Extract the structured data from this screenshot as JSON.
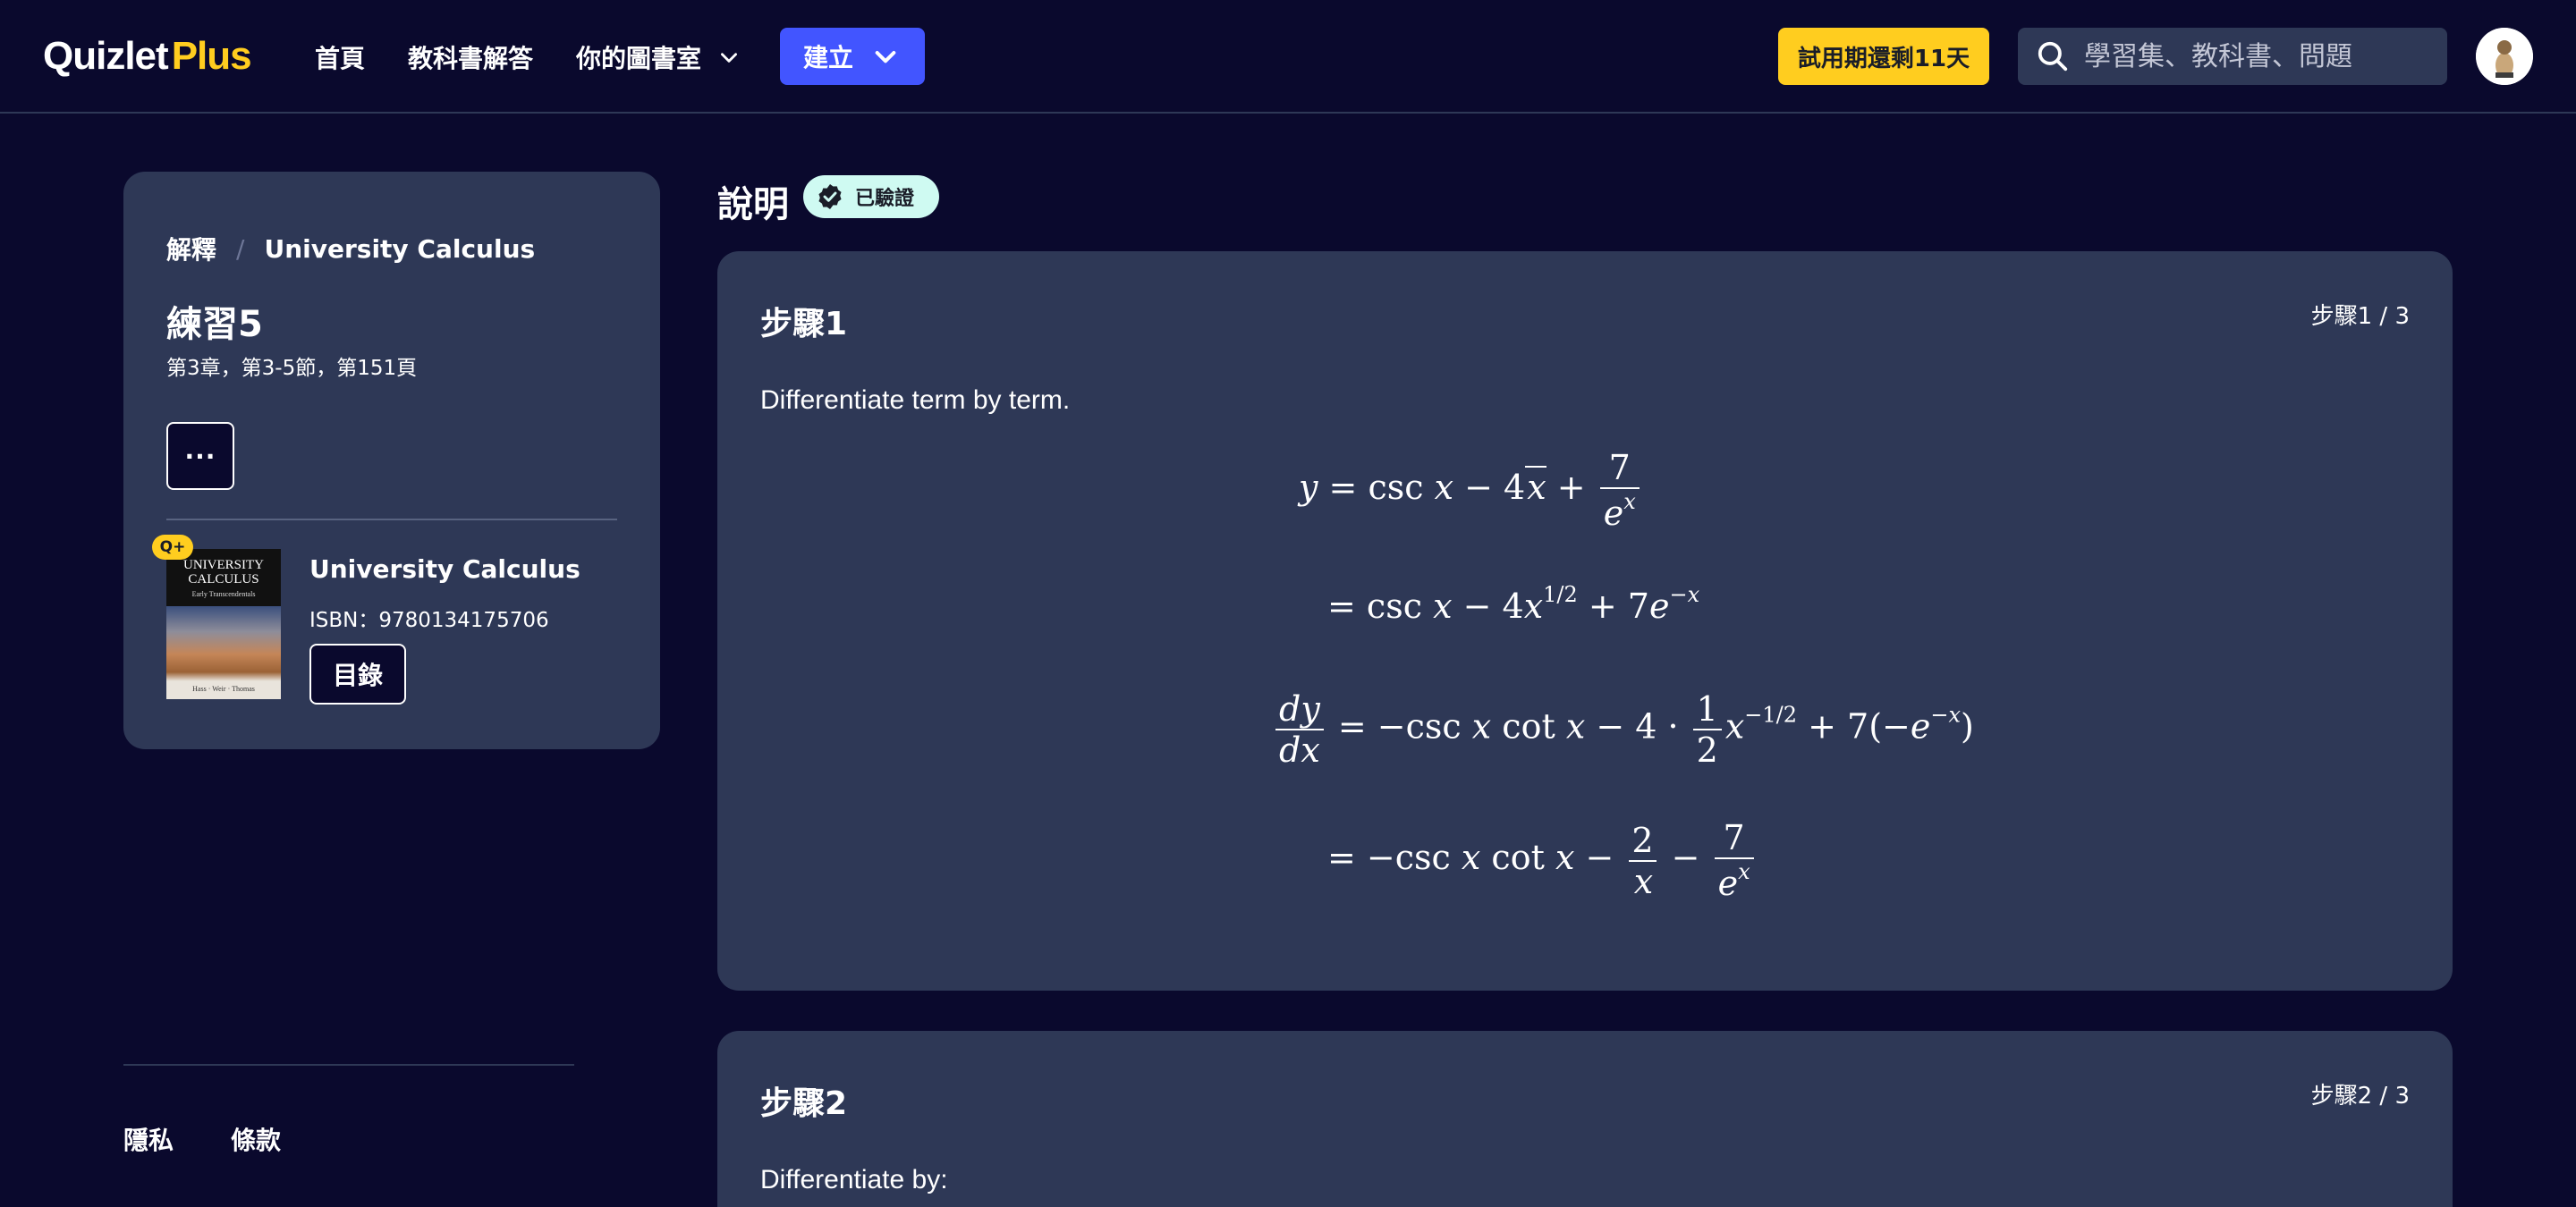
{
  "header": {
    "logo_main": "Quizlet",
    "logo_plus": "Plus",
    "nav_home": "首頁",
    "nav_solutions": "教科書解答",
    "nav_library": "你的圖書室",
    "create_label": "建立",
    "trial_label": "試用期還剩11天",
    "search_placeholder": "學習集、教科書、問題"
  },
  "sidebar": {
    "breadcrumb_root": "解釋",
    "breadcrumb_sep": "/",
    "breadcrumb_book": "University Calculus",
    "exercise_title": "練習5",
    "exercise_sub": "第3章，第3-5節，第151頁",
    "more_label": "···",
    "plus_badge": "Q+",
    "book": {
      "title": "University Calculus",
      "isbn": "ISBN：9780134175706",
      "cover_title": "UNIVERSITY CALCULUS",
      "cover_subtitle": "Early Transcendentals",
      "cover_authors": "Hass · Weir · Thomas",
      "toc_label": "目錄"
    }
  },
  "footer": {
    "privacy": "隱私",
    "terms": "條款"
  },
  "main": {
    "section_title": "說明",
    "verified_label": "已驗證",
    "steps": [
      {
        "title": "步驟1",
        "count": "步驟1 / 3",
        "text": "Differentiate term by term."
      },
      {
        "title": "步驟2",
        "count": "步驟2 / 3",
        "text": "Differentiate by:"
      }
    ]
  },
  "colors": {
    "background": "#0a092d",
    "card": "#2e3856",
    "accent": "#4255ff",
    "trial": "#ffcd1f",
    "verified": "#cffaf2"
  }
}
